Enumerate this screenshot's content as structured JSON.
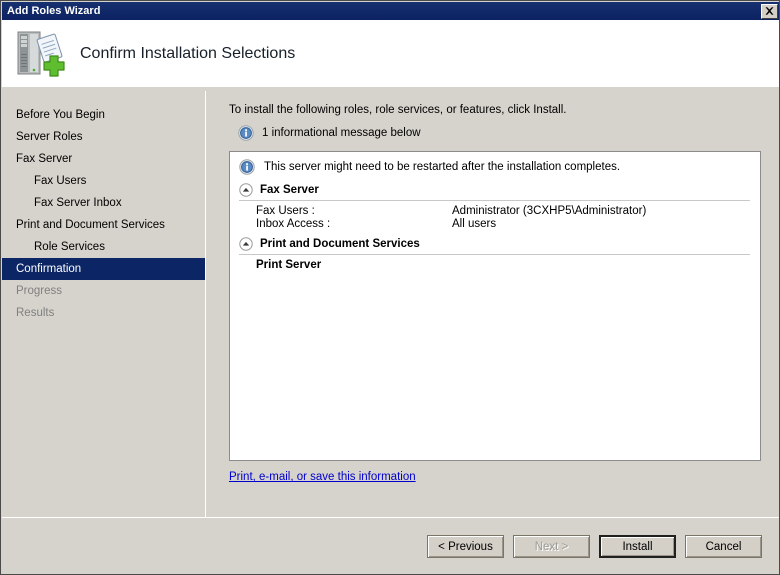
{
  "window": {
    "title": "Add Roles Wizard",
    "close_icon": "close-icon"
  },
  "header": {
    "icon": "add-roles-server-icon",
    "title": "Confirm Installation Selections"
  },
  "sidebar": {
    "items": [
      {
        "label": "Before You Begin",
        "level": 0,
        "state": "normal"
      },
      {
        "label": "Server Roles",
        "level": 0,
        "state": "normal"
      },
      {
        "label": "Fax Server",
        "level": 0,
        "state": "normal"
      },
      {
        "label": "Fax Users",
        "level": 1,
        "state": "normal"
      },
      {
        "label": "Fax Server Inbox",
        "level": 1,
        "state": "normal"
      },
      {
        "label": "Print and Document Services",
        "level": 0,
        "state": "normal"
      },
      {
        "label": "Role Services",
        "level": 1,
        "state": "normal"
      },
      {
        "label": "Confirmation",
        "level": 0,
        "state": "selected"
      },
      {
        "label": "Progress",
        "level": 0,
        "state": "disabled"
      },
      {
        "label": "Results",
        "level": 0,
        "state": "disabled"
      }
    ]
  },
  "main": {
    "intro": "To install the following roles, role services, or features, click Install.",
    "info_summary": "1 informational message below",
    "info_icon": "info-icon",
    "details": {
      "restart_note": "This server might need to be restarted after the installation completes.",
      "restart_icon": "info-icon",
      "groups": [
        {
          "title": "Fax Server",
          "collapse_icon": "chevron-up-circle-icon",
          "rows": [
            {
              "key": "Fax Users :",
              "value": "Administrator (3CXHP5\\Administrator)"
            },
            {
              "key": "Inbox Access :",
              "value": "All users"
            }
          ],
          "entries": []
        },
        {
          "title": "Print and Document Services",
          "collapse_icon": "chevron-up-circle-icon",
          "rows": [],
          "entries": [
            "Print Server"
          ]
        }
      ]
    },
    "print_link": "Print, e-mail, or save this information"
  },
  "footer": {
    "buttons": [
      {
        "label": "< Previous",
        "state": "normal"
      },
      {
        "label": "Next >",
        "state": "disabled"
      },
      {
        "label": "Install",
        "state": "default"
      },
      {
        "label": "Cancel",
        "state": "normal"
      }
    ]
  },
  "colors": {
    "titlebar": "#0c2262",
    "selection": "#0c2565",
    "window_face": "#d6d3cc",
    "link": "#0000cc",
    "info_blue": "#3f6fae",
    "plus_green": "#5fbe2f"
  }
}
